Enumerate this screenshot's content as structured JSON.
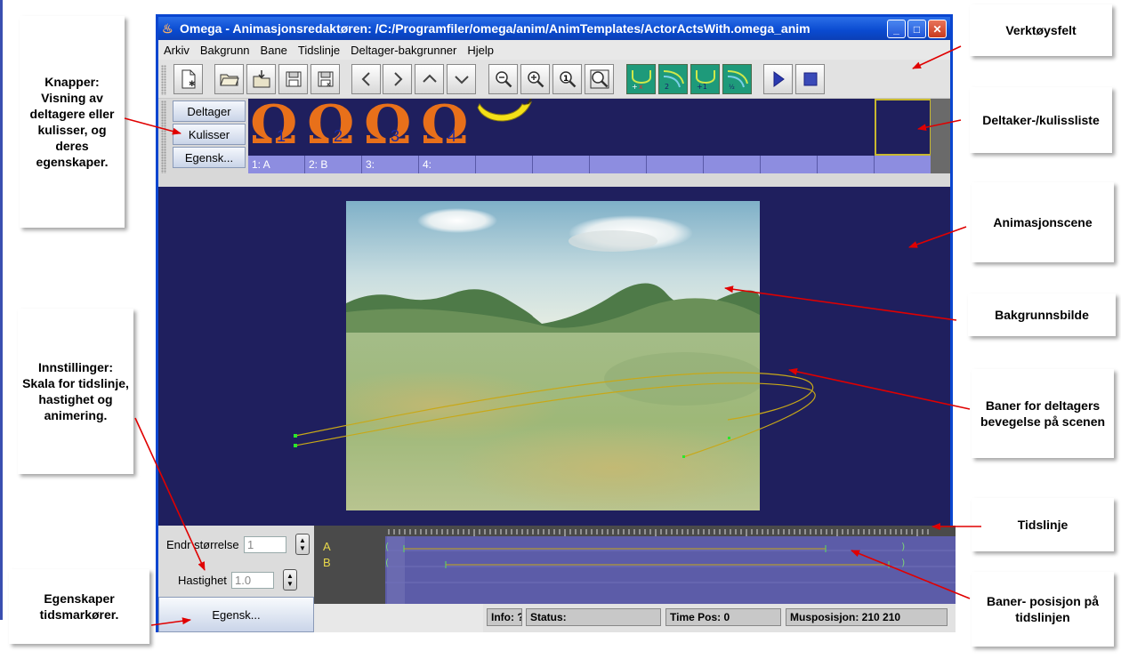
{
  "window": {
    "title": "Omega - Animasjonsredaktøren: /C:/Programfiler/omega/anim/AnimTemplates/ActorActsWith.omega_anim"
  },
  "menu": [
    "Arkiv",
    "Bakgrunn",
    "Bane",
    "Tidslinje",
    "Deltager-bakgrunner",
    "Hjelp"
  ],
  "toolbar_icons": [
    "new-file-icon",
    "open-folder-icon",
    "import-icon",
    "save-icon",
    "save-as-icon",
    "arrow-left-icon",
    "arrow-right-icon",
    "arrow-up-icon",
    "arrow-down-icon",
    "zoom-out-icon",
    "zoom-in-icon",
    "zoom-actual-icon",
    "zoom-fit-icon",
    "path-delete-icon",
    "path-two-icon",
    "path-add-icon",
    "path-half-icon",
    "play-icon",
    "stop-icon"
  ],
  "side_buttons": {
    "participants": "Deltager",
    "scenery": "Kulisser",
    "properties": "Egensk..."
  },
  "actors": [
    {
      "number": "1",
      "label": "1: A"
    },
    {
      "number": "2",
      "label": "2: B"
    },
    {
      "number": "3",
      "label": "3:"
    },
    {
      "number": "4",
      "label": "4:"
    }
  ],
  "settings": {
    "size_label": "Endr størrelse",
    "size_value": "1",
    "speed_label": "Hastighet",
    "speed_value": "1.0",
    "properties_button": "Egensk..."
  },
  "timeline": {
    "tracks": [
      "A",
      "B"
    ]
  },
  "status": {
    "info": "Info: ?",
    "status": "Status:",
    "time_pos": "Time Pos: 0",
    "mouse_pos": "Musposisjon: 210 210"
  },
  "callouts": {
    "buttons": "Knapper: Visning av deltagere eller kulisser, og deres egenskaper.",
    "settings": "Innstillinger: Skala for tidslinje, hastighet og animering.",
    "marker_props": "Egenskaper tidsmarkører.",
    "toolbar": "Verktøysfelt",
    "actor_list": "Deltaker-/kulissliste",
    "scene": "Animasjonscene",
    "background": "Bakgrunnsbilde",
    "paths": "Baner for deltagers bevegelse på scenen",
    "timeline": "Tidslinje",
    "path_positions": "Baner- posisjon på tidslinjen"
  },
  "colors": {
    "scene_bg": "#1f1f5e",
    "titlebar": "#0a4ad0",
    "omega_orange": "#e8701a",
    "arrow_red": "#e00000"
  }
}
